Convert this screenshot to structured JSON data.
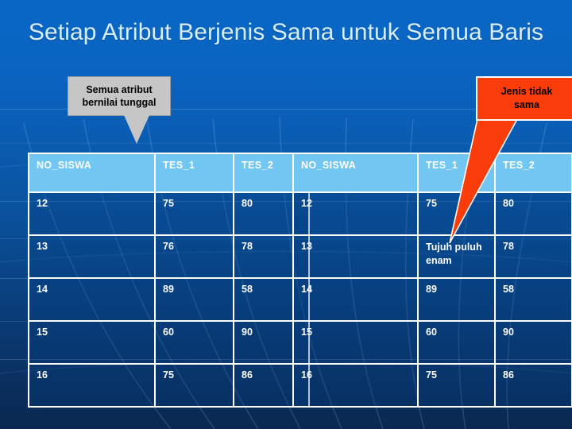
{
  "slide": {
    "title": "Setiap Atribut Berjenis Sama untuk Semua Baris",
    "background_top_color": "#0a67c7",
    "background_bottom_color": "#0a2851"
  },
  "callouts": {
    "gray": {
      "line1": "Semua atribut",
      "line2": "bernilai tunggal",
      "fill_color": "#c6c6c6",
      "text_color": "#000000"
    },
    "red": {
      "line1": "Jenis tidak",
      "line2": "sama",
      "fill_color": "#fa3c0a",
      "text_color": "#000000",
      "border_color": "#ffffff"
    }
  },
  "tables": {
    "header_fill": "#72c6f2",
    "border_color": "#ffffff",
    "left": {
      "columns": [
        "NO_SISWA",
        "TES_1",
        "TES_2"
      ],
      "rows": [
        [
          "12",
          "75",
          "80"
        ],
        [
          "13",
          "76",
          "78"
        ],
        [
          "14",
          "89",
          "58"
        ],
        [
          "15",
          "60",
          "90"
        ],
        [
          "16",
          "75",
          "86"
        ]
      ]
    },
    "right": {
      "columns": [
        "NO_SISWA",
        "TES_1",
        "TES_2"
      ],
      "rows": [
        [
          "12",
          "75",
          "80"
        ],
        [
          "13",
          "Tujuh puluh enam",
          "78"
        ],
        [
          "14",
          "89",
          "58"
        ],
        [
          "15",
          "60",
          "90"
        ],
        [
          "16",
          "75",
          "86"
        ]
      ]
    }
  }
}
